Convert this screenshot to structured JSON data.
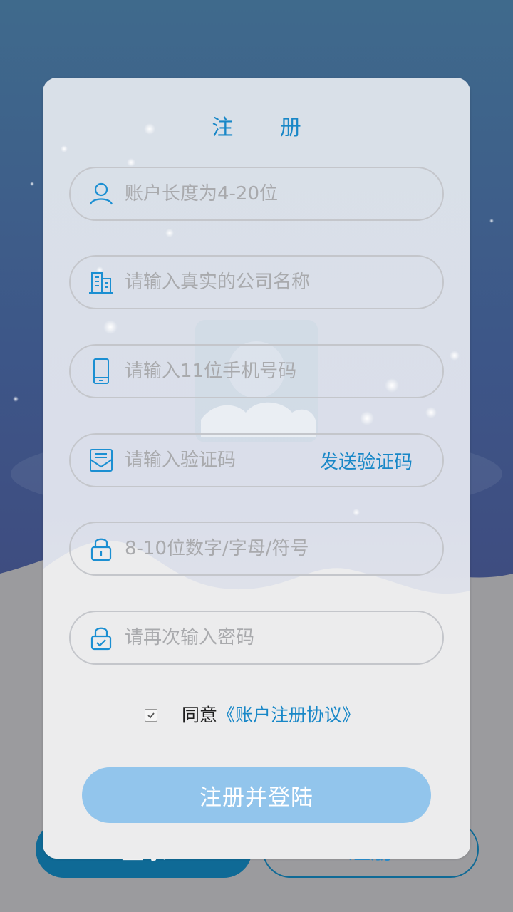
{
  "form": {
    "title": "注  册",
    "fields": {
      "account": {
        "placeholder": "账户长度为4-20位",
        "icon": "user-icon"
      },
      "company": {
        "placeholder": "请输入真实的公司名称",
        "icon": "building-icon"
      },
      "phone": {
        "placeholder": "请输入11位手机号码",
        "icon": "phone-icon"
      },
      "code": {
        "placeholder": "请输入验证码",
        "icon": "mail-icon",
        "action_label": "发送验证码"
      },
      "password": {
        "placeholder": "8-10位数字/字母/符号",
        "icon": "lock-icon"
      },
      "confirm": {
        "placeholder": "请再次输入密码",
        "icon": "lock-check-icon"
      }
    },
    "agreement": {
      "prefix": "同意",
      "link": "《账户注册协议》",
      "checked": true
    },
    "submit_label": "注册并登陆"
  },
  "bottom": {
    "login_label": "登录",
    "register_label": "注册"
  },
  "colors": {
    "accent": "#1887c7",
    "button": "#92c5ec",
    "dark_blue": "#0f6a96"
  }
}
